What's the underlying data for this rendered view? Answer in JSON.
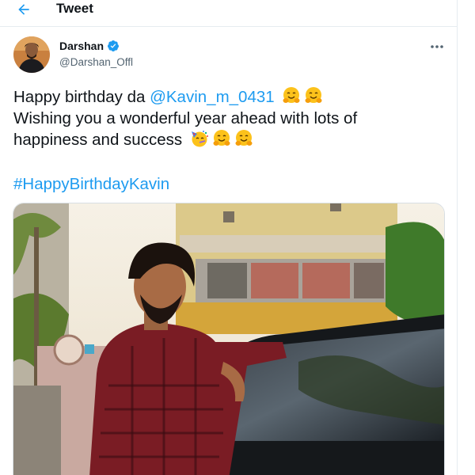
{
  "header": {
    "title": "Tweet",
    "back_icon": "arrow-left-icon"
  },
  "author": {
    "display_name": "Darshan",
    "handle": "@Darshan_Offl",
    "verified": true,
    "verified_icon": "verified-badge-icon"
  },
  "menu_icon": "more-horizontal-icon",
  "tweet": {
    "line1_text": "Happy birthday da ",
    "line1_mention": "@Kavin_m_0431",
    "line1_emojis": [
      "hugging-face-emoji",
      "hugging-face-emoji"
    ],
    "line2_text": "Wishing you a wonderful year ahead with lots of",
    "line3_text": "happiness and success",
    "line3_emojis": [
      "partying-face-emoji",
      "hugging-face-emoji",
      "hugging-face-emoji"
    ],
    "hashtag": "#HappyBirthdayKavin"
  },
  "colors": {
    "accent": "#1d9bf0",
    "text": "#0f1419",
    "secondary": "#536471"
  }
}
